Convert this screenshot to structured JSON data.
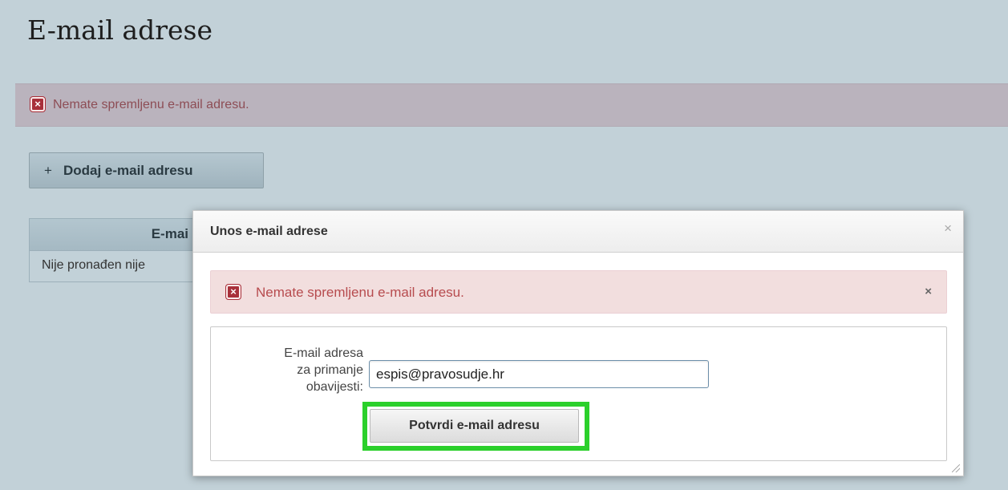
{
  "page": {
    "title": "E-mail adrese",
    "alert_message": "Nemate spremljenu e-mail adresu.",
    "add_button_icon": "+",
    "add_button_label": "Dodaj e-mail adresu",
    "table": {
      "header_visible": "E-mai",
      "empty_text_visible": "Nije pronađen nije"
    }
  },
  "dialog": {
    "title": "Unos e-mail adrese",
    "close_icon": "×",
    "alert_icon": "×",
    "alert_message": "Nemate spremljenu e-mail adresu.",
    "alert_close_icon": "×",
    "form": {
      "label_line1": "E-mail adresa",
      "label_line2": "za primanje",
      "label_line3": "obavijesti:",
      "email_value": "espis@pravosudje.hr",
      "confirm_button_label": "Potvrdi e-mail adresu"
    }
  },
  "colors": {
    "page_background": "#c2d1d8",
    "alert_text": "#b74b4e",
    "highlight": "#2bd02b"
  }
}
